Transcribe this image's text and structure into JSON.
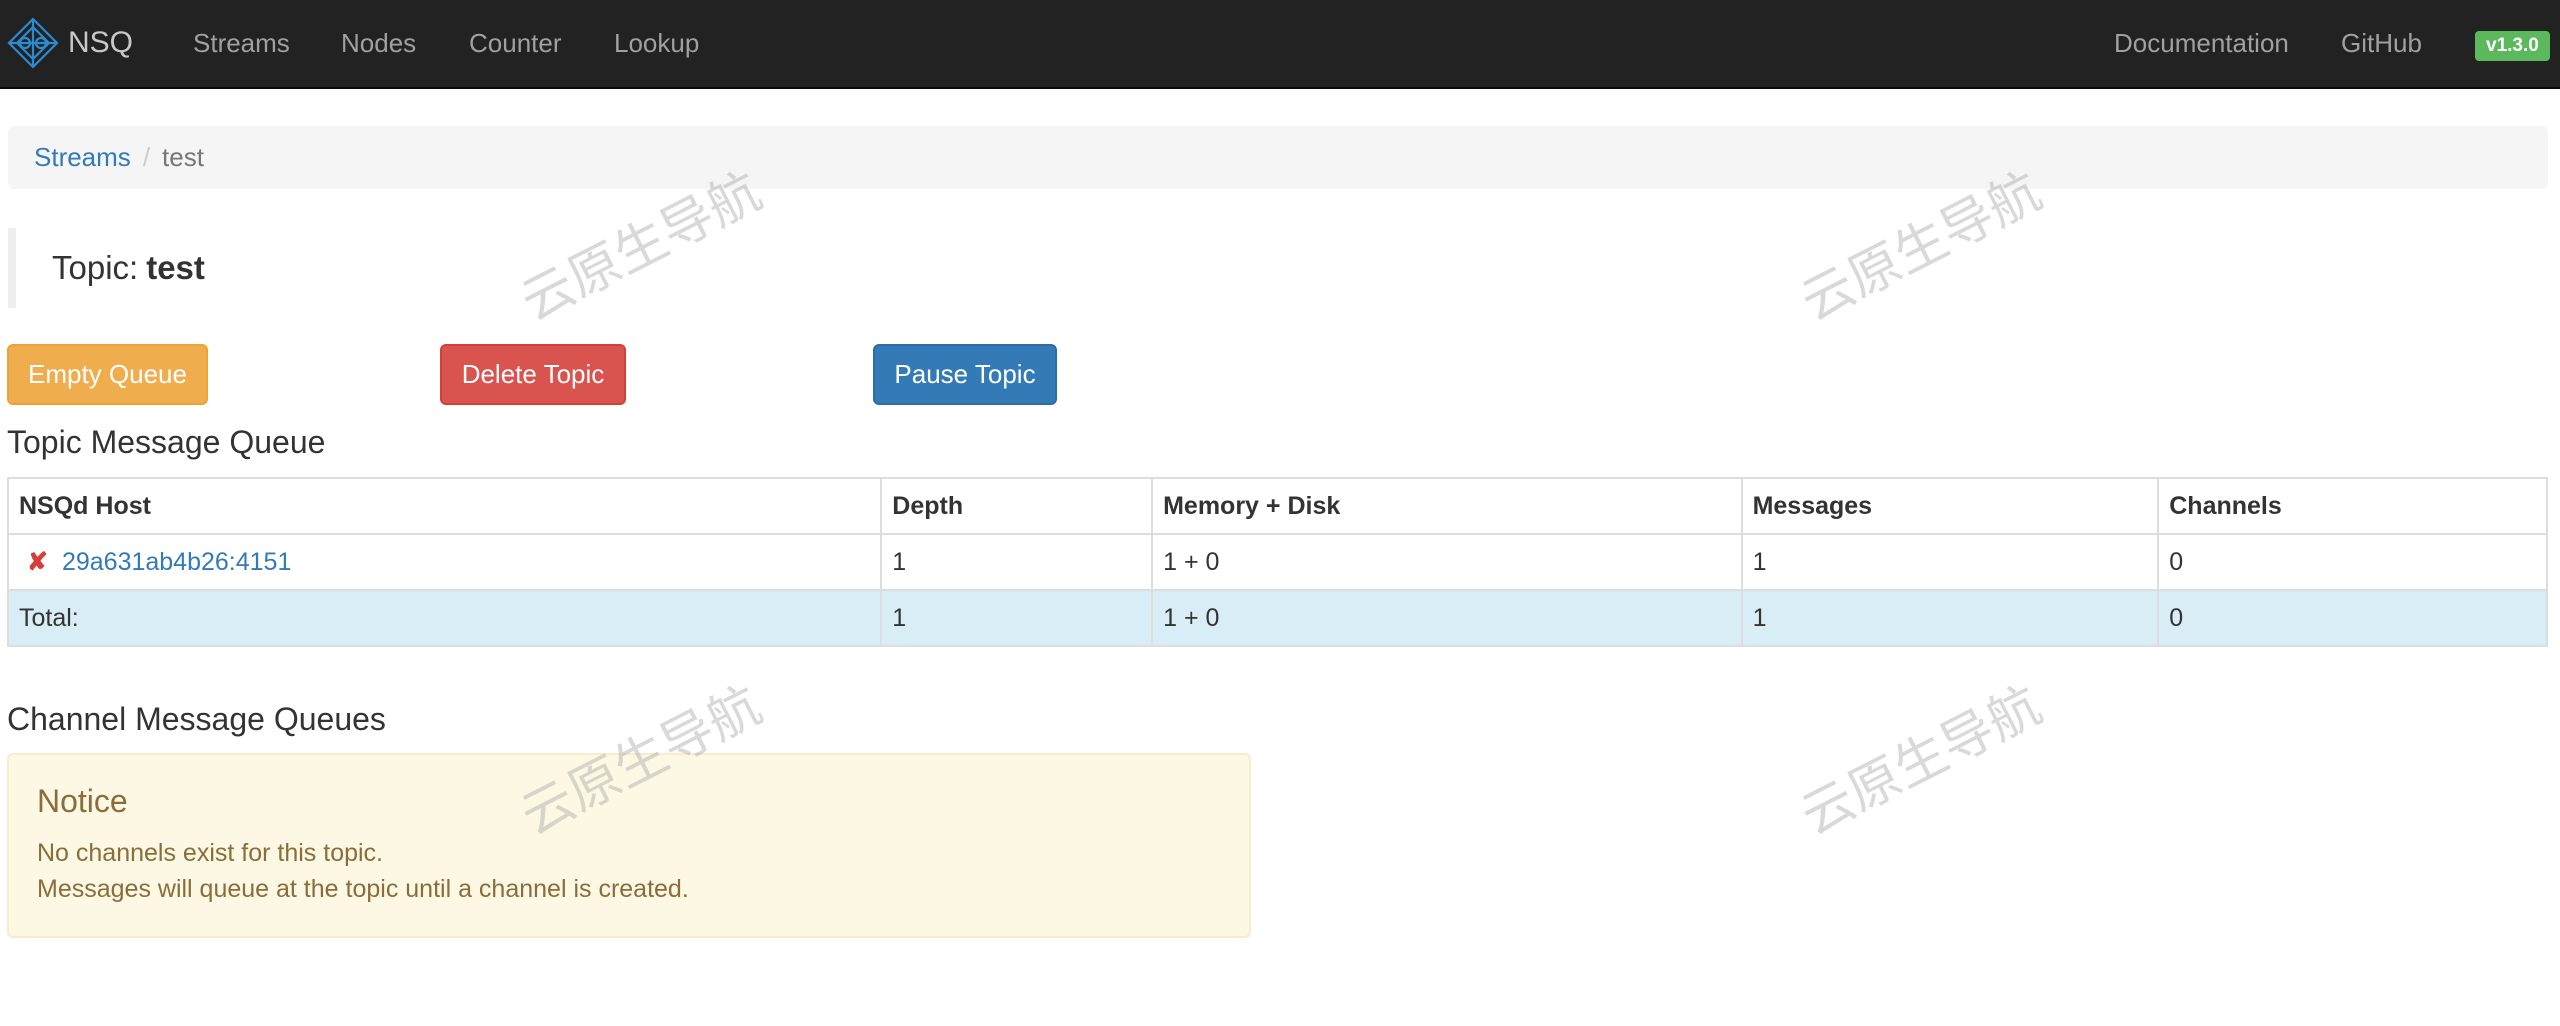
{
  "navbar": {
    "brand": "NSQ",
    "links": [
      "Streams",
      "Nodes",
      "Counter",
      "Lookup"
    ],
    "right_links": [
      "Documentation",
      "GitHub"
    ],
    "version": "v1.3.0"
  },
  "breadcrumb": {
    "parent": "Streams",
    "separator": "/",
    "current": "test"
  },
  "topic": {
    "label": "Topic:",
    "name": "test"
  },
  "actions": {
    "empty_queue": "Empty Queue",
    "delete_topic": "Delete Topic",
    "pause_topic": "Pause Topic"
  },
  "topic_queue": {
    "heading": "Topic Message Queue",
    "columns": [
      "NSQd Host",
      "Depth",
      "Memory + Disk",
      "Messages",
      "Channels"
    ],
    "rows": [
      {
        "host": "29a631ab4b26:4151",
        "depth": "1",
        "memory_disk": "1 + 0",
        "messages": "1",
        "channels": "0"
      }
    ],
    "total": {
      "label": "Total:",
      "depth": "1",
      "memory_disk": "1 + 0",
      "messages": "1",
      "channels": "0"
    }
  },
  "channel_queues": {
    "heading": "Channel Message Queues",
    "notice_title": "Notice",
    "notice_lines": [
      "No channels exist for this topic.",
      "Messages will queue at the topic until a channel is created."
    ]
  },
  "watermark": "云原生导航",
  "colors": {
    "navbar": "#222222",
    "link": "#337ab7",
    "warning": "#f0ad4e",
    "danger": "#d9534f",
    "primary": "#337ab7",
    "badge": "#5cb85c",
    "total_row": "#d9edf7",
    "notice_bg": "#fcf8e3"
  }
}
